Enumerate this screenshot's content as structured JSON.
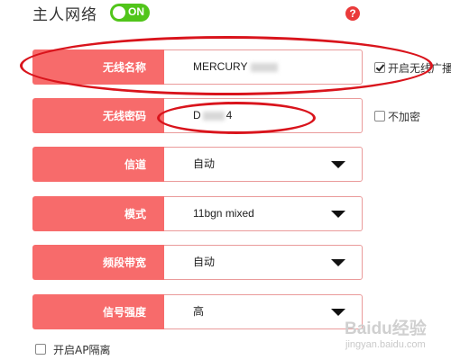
{
  "header": {
    "title": "主人网络",
    "toggle_label": "ON",
    "help_label": "?"
  },
  "rows": [
    {
      "label": "无线名称",
      "value": "MERCURY",
      "type": "text"
    },
    {
      "label": "无线密码",
      "value": "D",
      "value_suffix": "4",
      "type": "password"
    },
    {
      "label": "信道",
      "value": "自动",
      "type": "select"
    },
    {
      "label": "模式",
      "value": "11bgn mixed",
      "type": "select"
    },
    {
      "label": "频段带宽",
      "value": "自动",
      "type": "select"
    },
    {
      "label": "信号强度",
      "value": "高",
      "type": "select"
    }
  ],
  "side_options": {
    "broadcast_label": "开启无线广播",
    "broadcast_checked": true,
    "no_encrypt_label": "不加密",
    "no_encrypt_checked": false
  },
  "footer": {
    "ap_isolation_label": "开启AP隔离",
    "ap_isolation_checked": false
  },
  "watermark": {
    "brand": "Baidu经验",
    "url": "jingyan.baidu.com"
  },
  "colors": {
    "label_bg": "#f76b6b",
    "toggle_on": "#51c51a",
    "help": "#ea3a3a",
    "annotation": "#d9141c"
  }
}
